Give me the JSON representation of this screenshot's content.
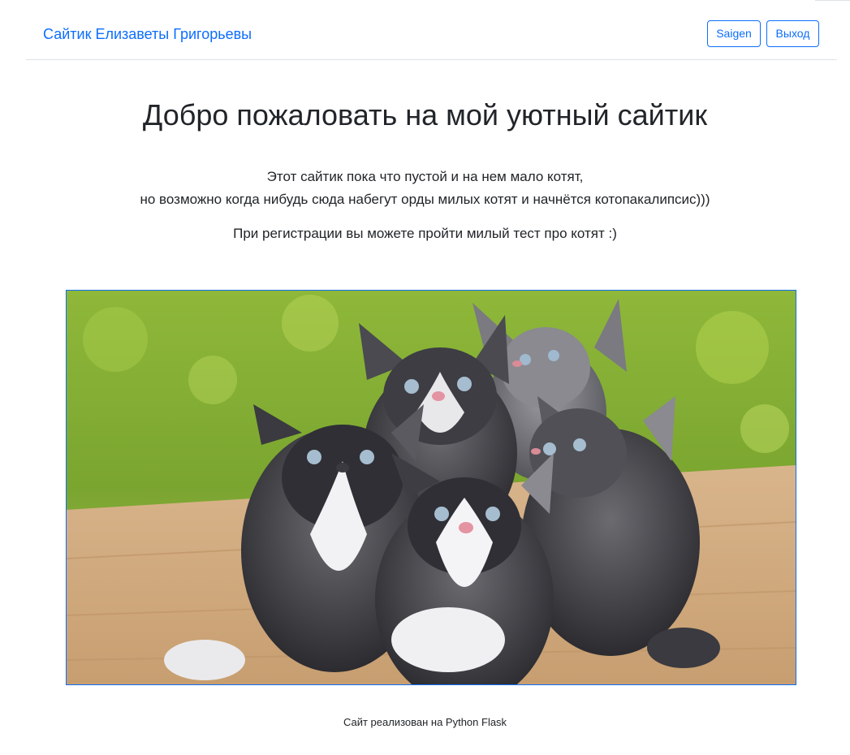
{
  "header": {
    "brand": "Сайтик Елизаветы Григорьевы",
    "user_button": "Saigen",
    "logout_button": "Выход"
  },
  "main": {
    "title": "Добро пожаловать на мой уютный сайтик",
    "intro_line1": "Этот сайтик пока что пустой и на нем мало котят,",
    "intro_line2": "но возможно когда нибудь сюда набегут орды милых котят и начнётся котопакалипсис)))",
    "registration_note": "При регистрации вы можете пройти милый тест про котят :)",
    "image": {
      "icon": "kittens-photo",
      "frame_color": "#0d6efd"
    }
  },
  "footer": {
    "text": "Сайт реализован на Python Flask"
  },
  "colors": {
    "accent": "#0d6efd",
    "text": "#212529",
    "divider": "#dee2e6"
  }
}
